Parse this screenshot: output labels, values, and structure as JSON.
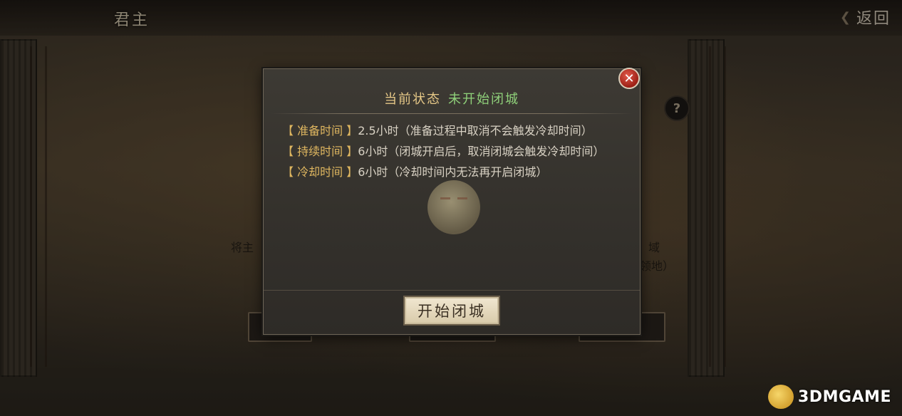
{
  "header": {
    "title": "君主",
    "back_label": "返回"
  },
  "background": {
    "left_text": "将主",
    "right_text_1": "域",
    "right_text_2": "领地）"
  },
  "dialog": {
    "status_label": "当前状态",
    "status_value": "未开始闭城",
    "rules": [
      {
        "key": "准备时间",
        "value": "2.5小时（准备过程中取消不会触发冷却时间）"
      },
      {
        "key": "持续时间",
        "value": "6小时（闭城开启后，取消闭城会触发冷却时间）"
      },
      {
        "key": "冷却时间",
        "value": "6小时（冷却时间内无法再开启闭城）"
      }
    ],
    "primary_button": "开始闭城",
    "close_icon": "close-icon"
  },
  "watermark": "3DMGAME",
  "colors": {
    "status_value": "#8fd17a",
    "rule_key": "#e0b760",
    "status_label": "#e6c887"
  }
}
